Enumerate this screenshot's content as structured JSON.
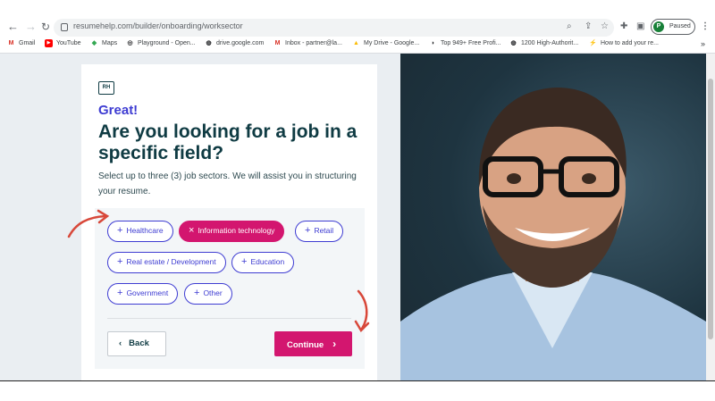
{
  "browser": {
    "url": "resumehelp.com/builder/onboarding/worksector",
    "profile_initial": "P",
    "profile_status": "Paused",
    "bookmarks": [
      {
        "label": "Gmail",
        "icon": "M",
        "color": "#d93025"
      },
      {
        "label": "YouTube",
        "icon": "▶",
        "color": "#ff0000"
      },
      {
        "label": "Maps",
        "icon": "◆",
        "color": "#34a853"
      },
      {
        "label": "Playground - Open...",
        "icon": "◎",
        "color": "#202124"
      },
      {
        "label": "drive.google.com",
        "icon": "◍",
        "color": "#202124"
      },
      {
        "label": "Inbox - partner@la...",
        "icon": "M",
        "color": "#d93025"
      },
      {
        "label": "My Drive - Google...",
        "icon": "▲",
        "color": "#fbbc04"
      },
      {
        "label": "Top 949+ Free Profi...",
        "icon": "◗",
        "color": "#202124"
      },
      {
        "label": "1200 High-Authorit...",
        "icon": "◍",
        "color": "#202124"
      },
      {
        "label": "How to add your re...",
        "icon": "⚡",
        "color": "#34a853"
      }
    ]
  },
  "page": {
    "logo": "RH",
    "greeting": "Great!",
    "title": "Are you looking for a job in a specific field?",
    "subtitle": "Select up to three (3) job sectors. We will assist you in structuring your resume.",
    "sectors": [
      {
        "label": "Healthcare",
        "selected": false
      },
      {
        "label": "Information technology",
        "selected": true
      },
      {
        "label": "Retail",
        "selected": false
      },
      {
        "label": "Real estate / Development",
        "selected": false
      },
      {
        "label": "Education",
        "selected": false
      },
      {
        "label": "Government",
        "selected": false
      },
      {
        "label": "Other",
        "selected": false
      }
    ],
    "back_label": "Back",
    "continue_label": "Continue"
  },
  "colors": {
    "accent": "#d3166f",
    "brand": "#3e3cd2",
    "title": "#0f3b43",
    "annotation_arrow": "#d8483a"
  }
}
